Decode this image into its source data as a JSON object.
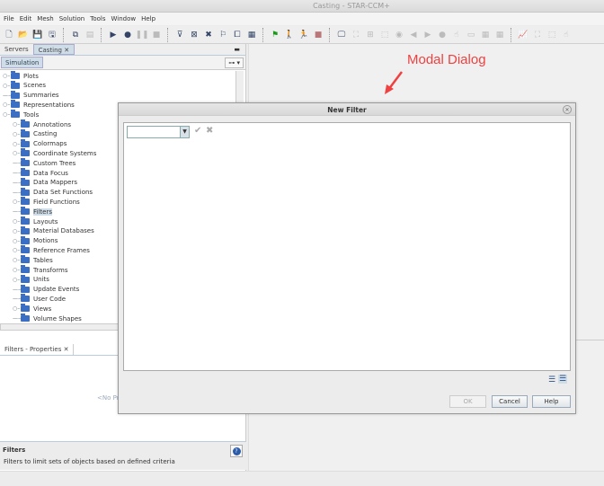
{
  "window": {
    "title": "Casting - STAR-CCM+"
  },
  "menu": [
    "File",
    "Edit",
    "Mesh",
    "Solution",
    "Tools",
    "Window",
    "Help"
  ],
  "toolbar": [
    {
      "icon": "new-icon",
      "g": "🗋"
    },
    {
      "icon": "open-icon",
      "g": "📂"
    },
    {
      "icon": "save-icon",
      "g": "💾"
    },
    {
      "icon": "save-as-icon",
      "g": "🖫"
    },
    "sep",
    {
      "icon": "copy-icon",
      "g": "⧉"
    },
    {
      "icon": "paste-icon",
      "g": "▤",
      "dis": true
    },
    "sep",
    {
      "icon": "run-icon",
      "g": "▶"
    },
    {
      "icon": "step-icon",
      "g": "●"
    },
    {
      "icon": "pause-icon",
      "g": "❚❚",
      "dis": true
    },
    {
      "icon": "stop-icon",
      "g": "■",
      "dis": true
    },
    "sep",
    {
      "icon": "mesh-filter-icon",
      "g": "⊽"
    },
    {
      "icon": "mesh-icon",
      "g": "⊠"
    },
    {
      "icon": "clear-mesh-icon",
      "g": "✖"
    },
    {
      "icon": "flag-outline-icon",
      "g": "⚐"
    },
    {
      "icon": "parts-icon",
      "g": "⧠"
    },
    {
      "icon": "grid-icon",
      "g": "▦"
    },
    "sep",
    {
      "icon": "flag-icon",
      "g": "⚑"
    },
    {
      "icon": "walk-icon",
      "g": "🚶"
    },
    {
      "icon": "run-man-icon",
      "g": "🏃"
    },
    {
      "icon": "stop-red-icon",
      "g": "■"
    },
    "sep",
    {
      "icon": "screen-icon",
      "g": "🖵"
    },
    {
      "icon": "fit-icon",
      "g": "⛶",
      "dis": true
    },
    {
      "icon": "reset-view-icon",
      "g": "⊞",
      "dis": true
    },
    {
      "icon": "select-icon",
      "g": "⬚",
      "dis": true
    },
    {
      "icon": "camera-icon",
      "g": "◉",
      "dis": true
    },
    {
      "icon": "back-icon",
      "g": "◀",
      "dis": true
    },
    {
      "icon": "forward-icon",
      "g": "▶",
      "dis": true
    },
    {
      "icon": "sphere-icon",
      "g": "●",
      "dis": true
    },
    {
      "icon": "hand-icon",
      "g": "☝",
      "dis": true
    },
    {
      "icon": "ruler-icon",
      "g": "▭",
      "dis": true
    },
    {
      "icon": "table-icon",
      "g": "▦",
      "dis": true
    },
    {
      "icon": "grid2-icon",
      "g": "▦",
      "dis": true
    },
    "sep",
    {
      "icon": "plot-icon",
      "g": "📈"
    },
    {
      "icon": "fit2-icon",
      "g": "⛶",
      "dis": true
    },
    {
      "icon": "select2-icon",
      "g": "⬚",
      "dis": true
    },
    {
      "icon": "hand2-icon",
      "g": "☝",
      "dis": true
    }
  ],
  "tabs": [
    "Servers",
    "Casting"
  ],
  "simulation_label": "Simulation",
  "tree": [
    {
      "label": "Plots",
      "lvl": 0,
      "exp": true
    },
    {
      "label": "Scenes",
      "lvl": 0,
      "exp": true
    },
    {
      "label": "Summaries",
      "lvl": 0,
      "exp": false
    },
    {
      "label": "Representations",
      "lvl": 0,
      "exp": true
    },
    {
      "label": "Tools",
      "lvl": 0,
      "exp": true,
      "open": true
    },
    {
      "label": "Annotations",
      "lvl": 1,
      "exp": true
    },
    {
      "label": "Casting",
      "lvl": 1,
      "exp": true
    },
    {
      "label": "Colormaps",
      "lvl": 1,
      "exp": true
    },
    {
      "label": "Coordinate Systems",
      "lvl": 1,
      "exp": true
    },
    {
      "label": "Custom Trees",
      "lvl": 1,
      "exp": false
    },
    {
      "label": "Data Focus",
      "lvl": 1,
      "exp": false
    },
    {
      "label": "Data Mappers",
      "lvl": 1,
      "exp": false
    },
    {
      "label": "Data Set Functions",
      "lvl": 1,
      "exp": false
    },
    {
      "label": "Field Functions",
      "lvl": 1,
      "exp": true
    },
    {
      "label": "Filters",
      "lvl": 1,
      "exp": false,
      "sel": true
    },
    {
      "label": "Layouts",
      "lvl": 1,
      "exp": true
    },
    {
      "label": "Material Databases",
      "lvl": 1,
      "exp": true
    },
    {
      "label": "Motions",
      "lvl": 1,
      "exp": true
    },
    {
      "label": "Reference Frames",
      "lvl": 1,
      "exp": true
    },
    {
      "label": "Tables",
      "lvl": 1,
      "exp": true
    },
    {
      "label": "Transforms",
      "lvl": 1,
      "exp": true
    },
    {
      "label": "Units",
      "lvl": 1,
      "exp": true
    },
    {
      "label": "Update Events",
      "lvl": 1,
      "exp": false
    },
    {
      "label": "User Code",
      "lvl": 1,
      "exp": false
    },
    {
      "label": "Views",
      "lvl": 1,
      "exp": true
    },
    {
      "label": "Volume Shapes",
      "lvl": 1,
      "exp": false
    }
  ],
  "properties": {
    "tab": "Filters - Properties",
    "empty": "<No Pr",
    "title": "Filters",
    "description": "Filters to limit sets of objects based on defined criteria"
  },
  "annotation": "Modal Dialog",
  "dialog": {
    "title": "New Filter",
    "combo_value": "",
    "ok": "OK",
    "cancel": "Cancel",
    "help": "Help"
  }
}
